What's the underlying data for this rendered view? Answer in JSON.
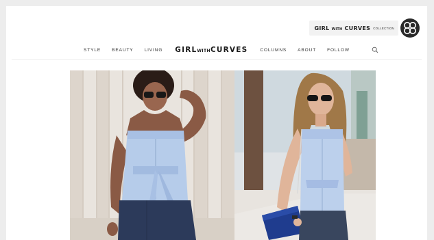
{
  "collection": {
    "brand_main": "GIRL",
    "brand_with": "WITH",
    "brand_curves": "CURVES",
    "brand_suffix": "COLLECTION",
    "logo_icon": "interlocking-circles-logo"
  },
  "nav": {
    "left": [
      "STYLE",
      "BEAUTY",
      "LIVING"
    ],
    "brand_main": "GIRL",
    "brand_with": "WITH",
    "brand_curves": "CURVES",
    "right": [
      "COLUMNS",
      "ABOUT",
      "FOLLOW"
    ],
    "search_icon": "search-icon"
  },
  "photos": [
    {
      "name": "woman-light-blue-tie-top-photo"
    },
    {
      "name": "woman-light-blue-top-blue-bag-photo"
    }
  ]
}
